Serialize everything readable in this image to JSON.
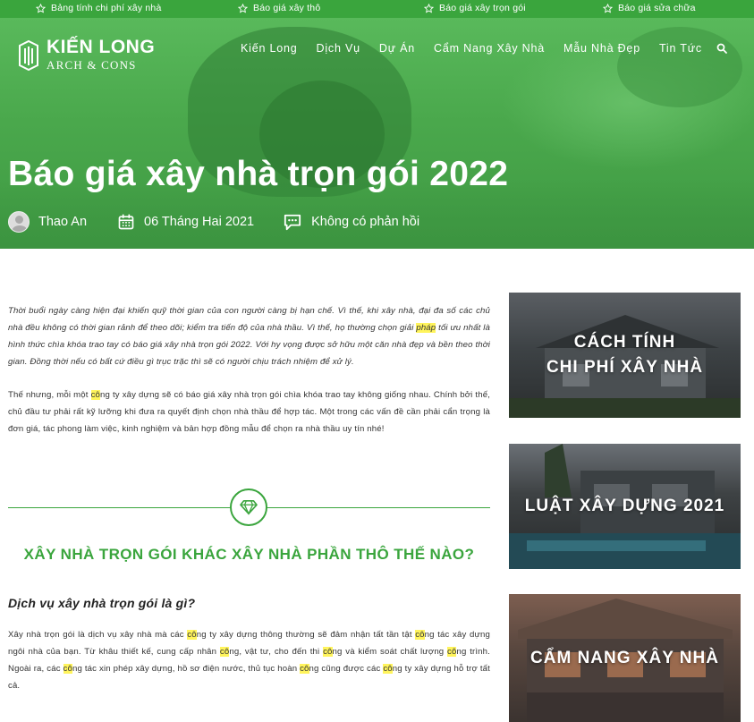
{
  "topbar": {
    "links": [
      "Bảng tính chi phí xây nhà",
      "Báo giá xây thô",
      "Báo giá xây trọn gói",
      "Báo giá sửa chữa"
    ]
  },
  "logo": {
    "name": "KIẾN LONG",
    "sub": "ARCH & CONS"
  },
  "nav": [
    "Kiến Long",
    "Dịch Vụ",
    "Dự Án",
    "Cẩm Nang Xây Nhà",
    "Mẫu Nhà Đẹp",
    "Tin Tức"
  ],
  "hero": {
    "title": "Báo giá xây nhà trọn gói 2022",
    "author": "Thao An",
    "date": "06 Tháng Hai 2021",
    "comments": "Không có phản hồi"
  },
  "article": {
    "intro": [
      {
        "t": "Thời buổi ngày càng hiện đại khiến quỹ thời gian của con người càng bị hạn chế. Vì thế, khi xây nhà, đại đa số các chủ nhà đều không có thời gian rảnh để theo dõi; kiểm tra tiến độ của nhà thầu. Vì thế, họ thường chọn giải "
      },
      {
        "t": "pháp",
        "hl": true
      },
      {
        "t": " tối ưu nhất là hình thức chìa khóa trao tay có báo giá xây nhà trọn gói 2022. Với hy vọng được sở hữu một căn nhà đẹp và bền theo thời gian. Đồng thời nếu có bất cứ điều gì trục trặc thì sẽ có người chịu trách nhiệm để xử lý."
      }
    ],
    "para2": [
      {
        "t": "Thế nhưng, mỗi một "
      },
      {
        "t": "cô",
        "hl": true
      },
      {
        "t": "ng ty xây dựng sẽ có báo giá xây nhà trọn gói chìa khóa trao tay không giống nhau. Chính bởi thế, chủ đầu tư phải rất kỹ lưỡng khi đưa ra quyết định chọn nhà thầu để hợp tác. Một trong các vấn đề cần phải cẩn trọng là đơn giá, tác phong làm việc, kinh nghiệm và bản hợp đồng mẫu để chọn ra nhà thầu uy tín nhé!"
      }
    ],
    "h2": "XÂY NHÀ TRỌN GÓI KHÁC XÂY NHÀ PHẦN THÔ THẾ NÀO?",
    "h3": "Dịch vụ xây nhà trọn gói là gì?",
    "para3": [
      {
        "t": "Xây nhà trọn gói là dịch vụ xây nhà mà các "
      },
      {
        "t": "cô",
        "hl": true
      },
      {
        "t": "ng ty xây dựng thông thường sẽ đảm nhận tất tần tật "
      },
      {
        "t": "cô",
        "hl": true
      },
      {
        "t": "ng tác xây dựng ngôi nhà của bạn. Từ khâu thiết kế, cung cấp nhân "
      },
      {
        "t": "cô",
        "hl": true
      },
      {
        "t": "ng, vật tư, cho đến thi "
      },
      {
        "t": "cô",
        "hl": true
      },
      {
        "t": "ng và kiểm soát chất lượng "
      },
      {
        "t": "cô",
        "hl": true
      },
      {
        "t": "ng trình. Ngoài ra, các "
      },
      {
        "t": "cô",
        "hl": true
      },
      {
        "t": "ng tác xin phép xây dựng, hồ sơ điện nước, thủ tục hoàn "
      },
      {
        "t": "cô",
        "hl": true
      },
      {
        "t": "ng cũng được các "
      },
      {
        "t": "cô",
        "hl": true
      },
      {
        "t": "ng ty xây dựng hỗ trợ tất cả."
      }
    ]
  },
  "sidebar": {
    "cards": [
      {
        "line1": "CÁCH TÍNH",
        "line2": "CHI PHÍ XÂY NHÀ"
      },
      {
        "line1": "LUẬT XÂY DỰNG 2021",
        "line2": ""
      },
      {
        "line1": "CẨM NANG XÂY NHÀ",
        "line2": ""
      }
    ]
  },
  "colors": {
    "brand_green": "#3aa53d",
    "highlight": "#fff45c"
  },
  "icons": [
    "star-icon",
    "search-icon",
    "calendar-icon",
    "comment-icon",
    "diamond-icon",
    "logo-mark-icon"
  ]
}
